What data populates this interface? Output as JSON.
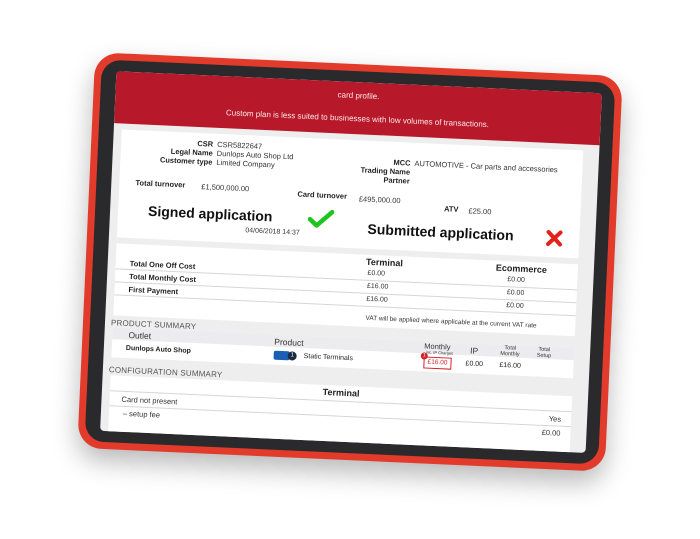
{
  "banner": {
    "line1": "card profile.",
    "line2": "Custom plan is less suited to businesses with low volumes of transactions."
  },
  "info": {
    "csr_label": "CSR",
    "csr_value": "CSR5822647",
    "legal_name_label": "Legal Name",
    "legal_name_value": "Dunlops Auto Shop Ltd",
    "customer_type_label": "Customer type",
    "customer_type_value": "Limited Company",
    "mcc_label": "MCC",
    "mcc_value": "AUTOMOTIVE - Car parts and accessories",
    "trading_name_label": "Trading Name",
    "partner_label": "Partner",
    "total_turnover_label": "Total turnover",
    "total_turnover_value": "£1,500,000.00",
    "card_turnover_label": "Card turnover",
    "card_turnover_value": "£495,000.00",
    "atv_label": "ATV",
    "atv_value": "£25.00"
  },
  "status": {
    "signed_label": "Signed application",
    "signed_date": "04/06/2018 14:37",
    "signed_icon": "check-icon",
    "submitted_label": "Submitted application",
    "submitted_icon": "cross-icon"
  },
  "costs": {
    "col_terminal": "Terminal",
    "col_ecommerce": "Ecommerce",
    "rows": [
      {
        "label": "Total One Off Cost",
        "terminal": "£0.00",
        "ecommerce": "£0.00"
      },
      {
        "label": "Total Monthly Cost",
        "terminal": "£16.00",
        "ecommerce": "£0.00"
      },
      {
        "label": "First Payment",
        "terminal": "£16.00",
        "ecommerce": "£0.00"
      }
    ],
    "vat_note": "VAT will be applied where applicable at the current VAT rate"
  },
  "product_summary": {
    "title": "PRODUCT SUMMARY",
    "headers": {
      "outlet": "Outlet",
      "product": "Product",
      "monthly": "Monthly",
      "monthly_sub": "inc. IP Charges",
      "ip": "IP",
      "total_monthly": "Total Monthly",
      "total_setup": "Total Setup"
    },
    "row": {
      "outlet": "Dunlops Auto Shop",
      "badge_count": "1",
      "product": "Static Terminals",
      "monthly": "£16.00",
      "ip": "£0.00",
      "total_monthly": "£16.00",
      "total_setup": "",
      "alert_count": "1"
    }
  },
  "config_summary": {
    "title": "CONFIGURATION SUMMARY",
    "header": "Terminal",
    "rows": [
      {
        "label": "Card not present",
        "value": "Yes"
      },
      {
        "label": "– setup fee",
        "value": "£0.00"
      }
    ]
  },
  "colors": {
    "tablet_shell": "#e23b2c",
    "banner": "#b8192a",
    "check": "#1fc51f",
    "cross": "#e2231a"
  }
}
